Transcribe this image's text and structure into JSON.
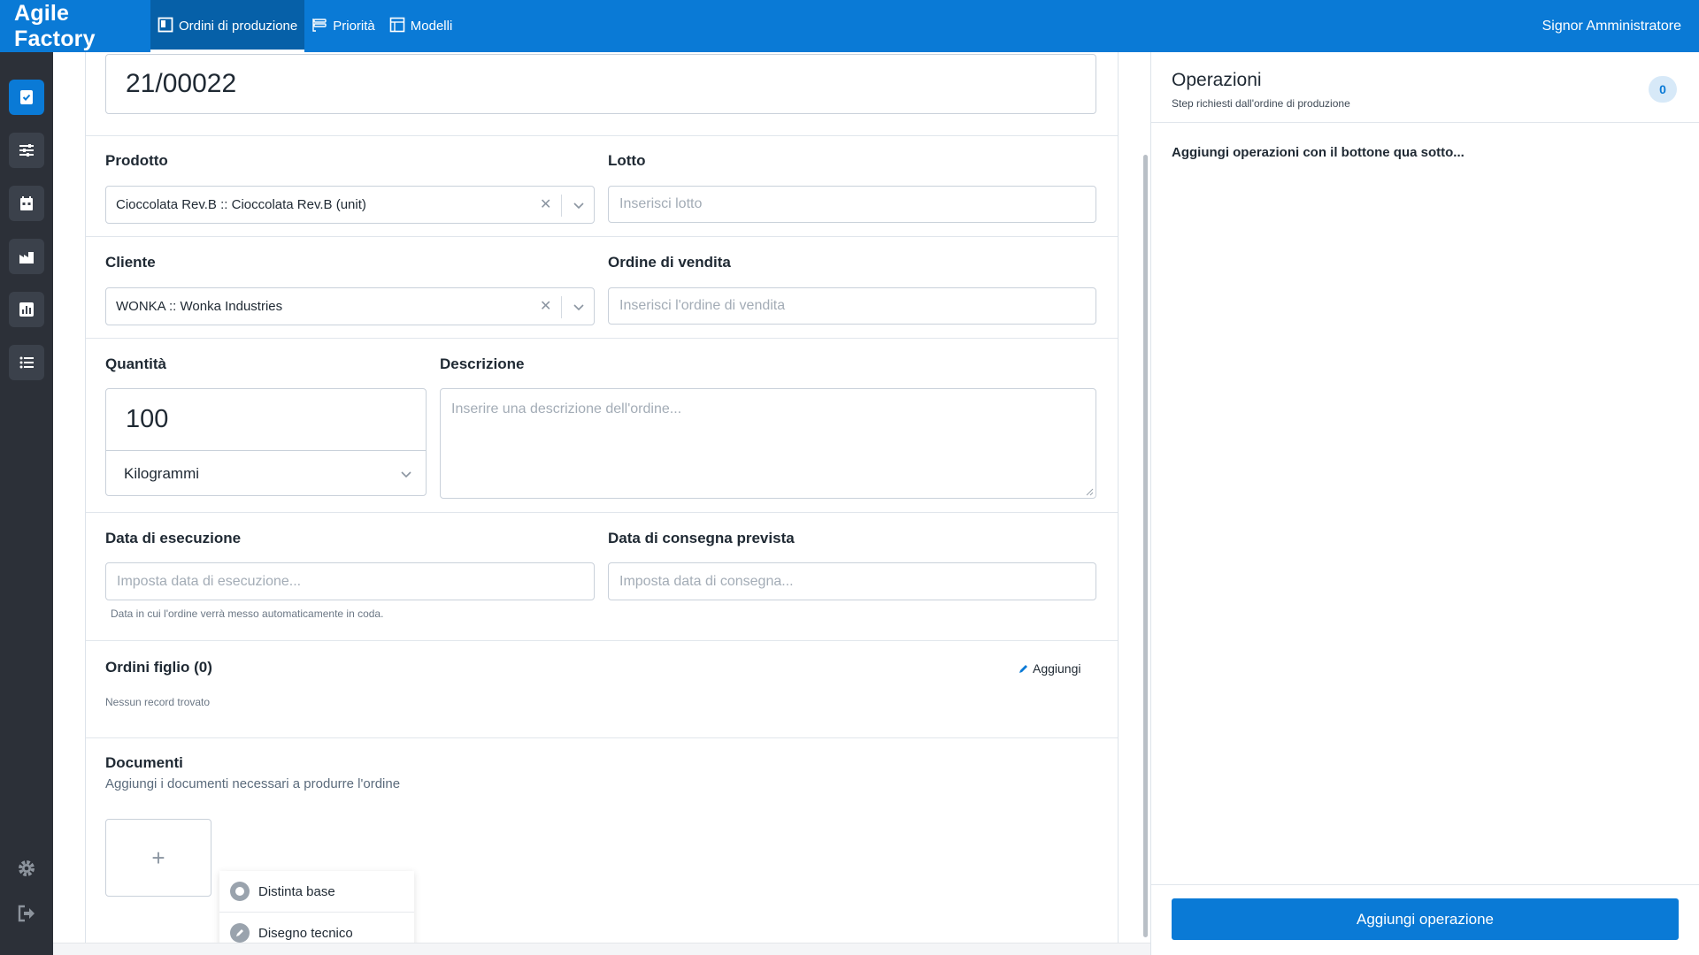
{
  "app": {
    "brand": "Agile Factory",
    "user": "Signor Amministratore"
  },
  "nav": {
    "tabs": [
      {
        "label": "Ordini di produzione",
        "icon": "board-icon",
        "active": true
      },
      {
        "label": "Priorità",
        "icon": "priority-icon",
        "active": false
      },
      {
        "label": "Modelli",
        "icon": "models-icon",
        "active": false
      }
    ]
  },
  "sidebar": {
    "items": [
      "orders-icon",
      "sliders-icon",
      "calendar-icon",
      "factory-icon",
      "report-icon",
      "list-icon"
    ],
    "bottom": [
      "gear-icon",
      "logout-icon"
    ]
  },
  "form": {
    "order_number": "21/00022",
    "product": {
      "label": "Prodotto",
      "value": "Cioccolata Rev.B :: Cioccolata Rev.B (unit)"
    },
    "lot": {
      "label": "Lotto",
      "placeholder": "Inserisci lotto"
    },
    "customer": {
      "label": "Cliente",
      "value": "WONKA :: Wonka Industries"
    },
    "sales_order": {
      "label": "Ordine di vendita",
      "placeholder": "Inserisci l'ordine di vendita"
    },
    "quantity": {
      "label": "Quantità",
      "value": "100",
      "unit": "Kilogrammi"
    },
    "description": {
      "label": "Descrizione",
      "placeholder": "Inserire una descrizione dell'ordine..."
    },
    "exec_date": {
      "label": "Data di esecuzione",
      "placeholder": "Imposta data di esecuzione...",
      "help": "Data in cui l'ordine verrà messo automaticamente in coda."
    },
    "delivery_date": {
      "label": "Data di consegna prevista",
      "placeholder": "Imposta data di consegna..."
    },
    "child_orders": {
      "label": "Ordini figlio (0)",
      "add": "Aggiungi",
      "empty": "Nessun record trovato"
    },
    "documents": {
      "label": "Documenti",
      "subtitle": "Aggiungi i documenti necessari a produrre l'ordine",
      "add_symbol": "+"
    },
    "doc_menu": [
      "Distinta base",
      "Disegno tecnico"
    ]
  },
  "operations": {
    "title": "Operazioni",
    "subtitle": "Step richiesti dall'ordine di produzione",
    "count": "0",
    "empty": "Aggiungi operazioni con il bottone qua sotto...",
    "add_button": "Aggiungi operazione"
  },
  "colors": {
    "accent": "#0a7ad6",
    "sidebar": "#2c3038"
  }
}
